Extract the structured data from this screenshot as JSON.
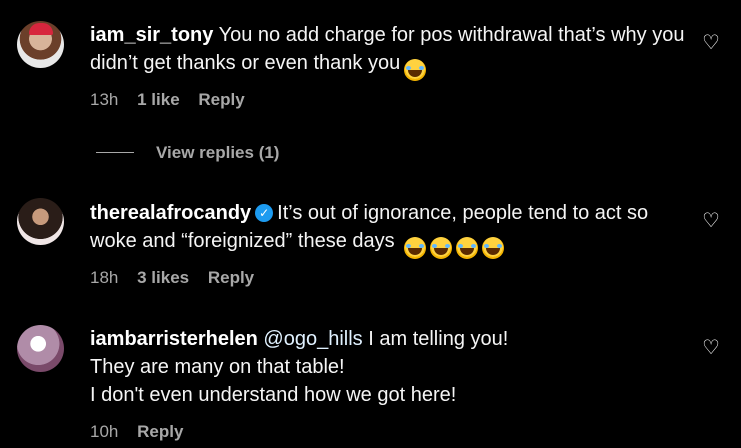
{
  "comments": [
    {
      "username": "iam_sir_tony",
      "text": "You no add charge for pos withdrawal that’s why you didn’t get thanks or even thank you",
      "emojis": [
        "face-with-tears-of-joy"
      ],
      "time": "13h",
      "likes": "1 like",
      "reply": "Reply"
    },
    {
      "username": "therealafrocandy",
      "verified": true,
      "text": "It’s out of ignorance, people tend to act so woke and “foreignized” these days",
      "emojis": [
        "face-with-tears-of-joy",
        "face-with-tears-of-joy",
        "face-with-tears-of-joy",
        "face-with-tears-of-joy"
      ],
      "time": "18h",
      "likes": "3 likes",
      "reply": "Reply"
    },
    {
      "username": "iambarristerhelen",
      "mention": "@ogo_hills",
      "line1": "I am telling you!",
      "line2": "They are many on that table!",
      "line3": "I don't even understand how we got here!",
      "time": "10h",
      "reply": "Reply"
    }
  ],
  "view_replies": "View replies (1)",
  "icons": {
    "like": "heart-outline-icon",
    "verified": "verified-badge-icon"
  },
  "colors": {
    "background": "#000000",
    "meta": "#a8a8a8",
    "verified": "#1d9bf0"
  }
}
